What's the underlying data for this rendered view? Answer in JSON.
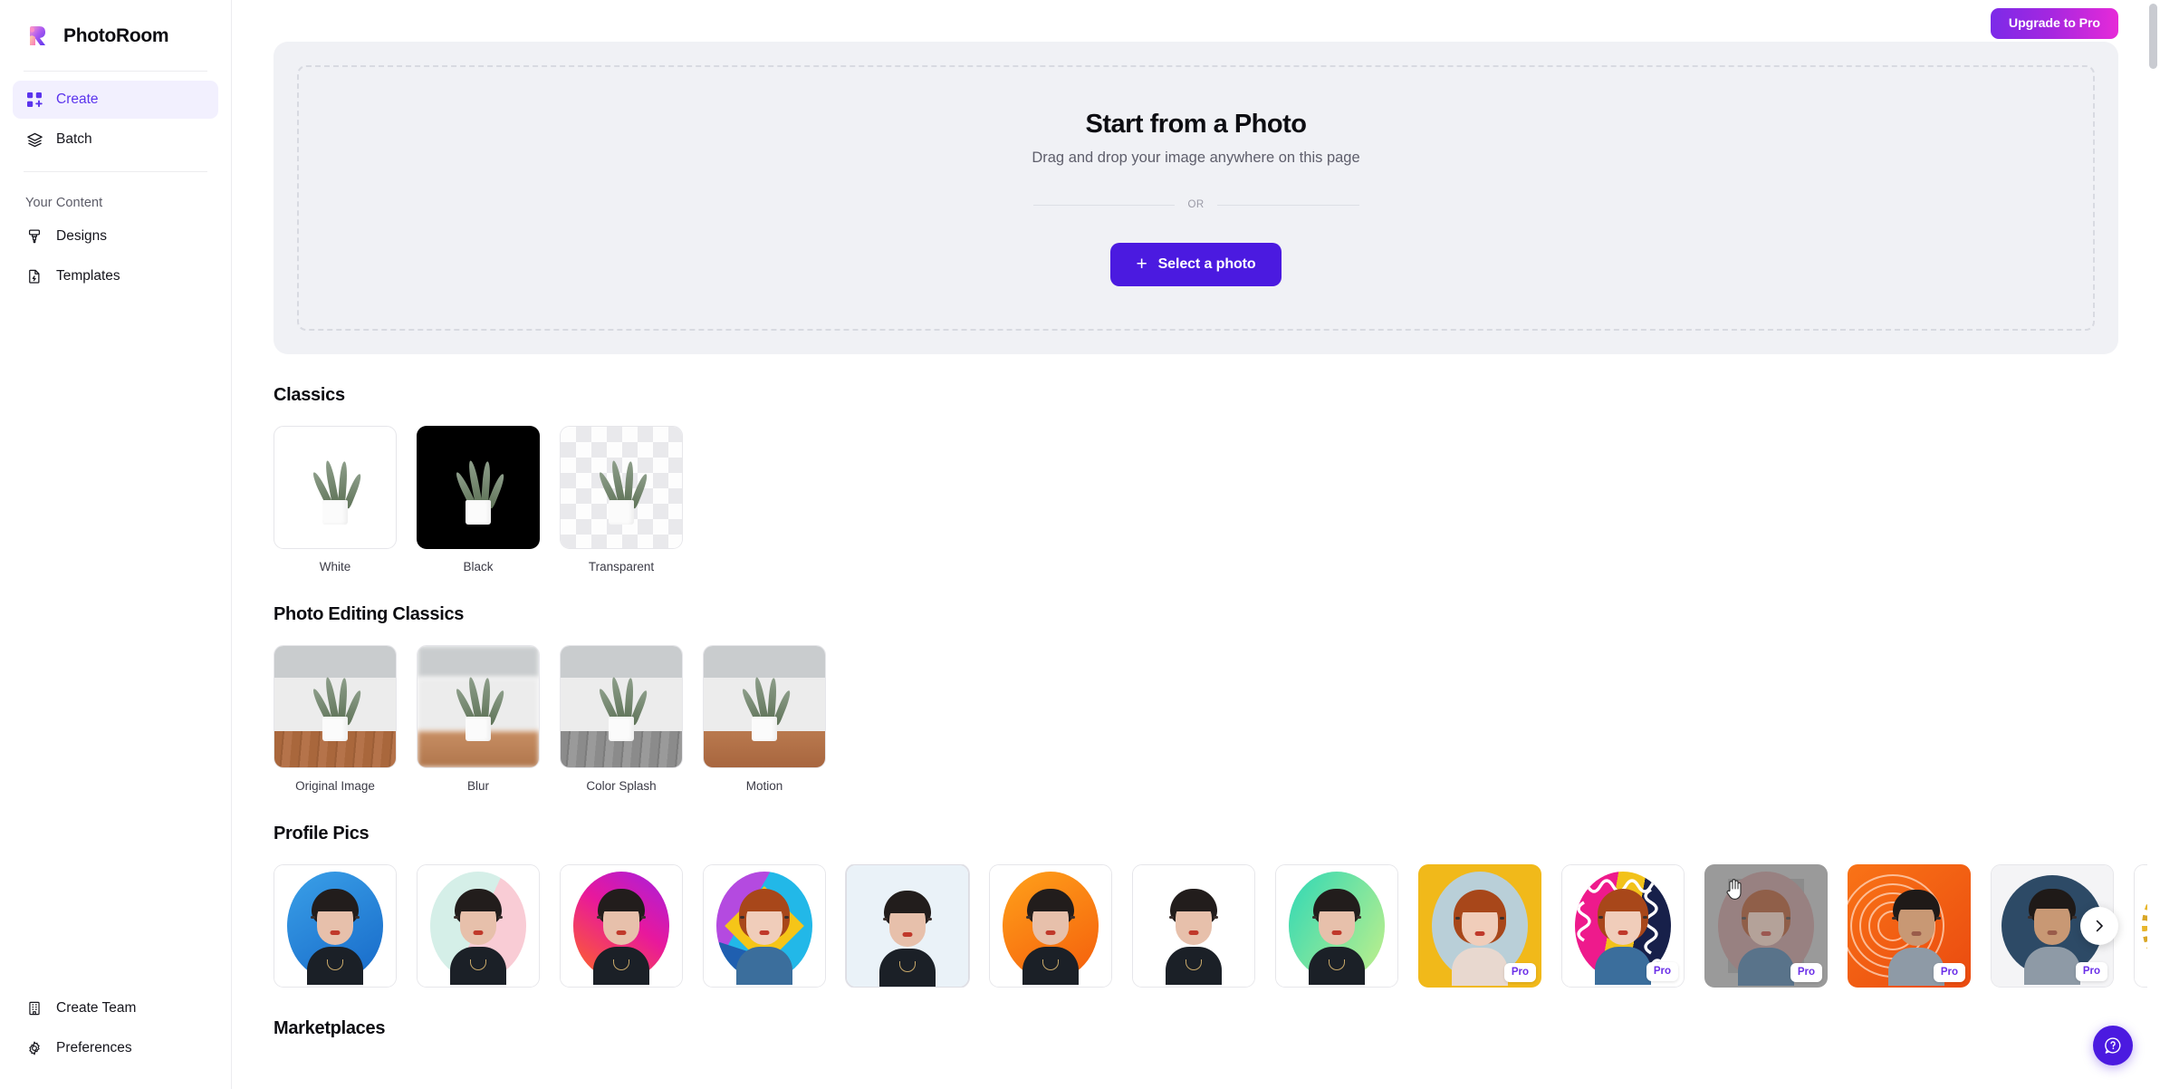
{
  "app": {
    "brand_name": "PhotoRoom",
    "logo_icon": "photoroom-logo-icon"
  },
  "sidebar": {
    "primary_items": [
      {
        "label": "Create",
        "icon": "grid-plus-icon",
        "active": true
      },
      {
        "label": "Batch",
        "icon": "layers-icon",
        "active": false
      }
    ],
    "section_label": "Your Content",
    "content_items": [
      {
        "label": "Designs",
        "icon": "paint-brush-icon"
      },
      {
        "label": "Templates",
        "icon": "template-file-icon"
      }
    ],
    "bottom_items": [
      {
        "label": "Create Team",
        "icon": "building-icon"
      },
      {
        "label": "Preferences",
        "icon": "gear-icon"
      }
    ]
  },
  "topbar": {
    "upgrade_label": "Upgrade to Pro"
  },
  "hero": {
    "title": "Start from a Photo",
    "subtitle": "Drag and drop your image anywhere on this page",
    "divider_label": "OR",
    "cta_label": "Select a photo",
    "cta_icon": "plus-icon"
  },
  "sections": [
    {
      "id": "classics",
      "title": "Classics",
      "items": [
        {
          "label": "White",
          "style": "white"
        },
        {
          "label": "Black",
          "style": "black"
        },
        {
          "label": "Transparent",
          "style": "transparent"
        }
      ]
    },
    {
      "id": "photo-editing-classics",
      "title": "Photo Editing Classics",
      "items": [
        {
          "label": "Original Image",
          "style": "original"
        },
        {
          "label": "Blur",
          "style": "blur"
        },
        {
          "label": "Color Splash",
          "style": "splash"
        },
        {
          "label": "Motion",
          "style": "motion"
        }
      ]
    },
    {
      "id": "profile-pics",
      "title": "Profile Pics",
      "items": [
        {
          "label": "",
          "pro": false,
          "bg": "blue-gradient",
          "subject": "woman-dark-hair"
        },
        {
          "label": "",
          "pro": false,
          "bg": "mint-pink-split",
          "subject": "woman-dark-hair"
        },
        {
          "label": "",
          "pro": false,
          "bg": "magenta-orange-gradient",
          "subject": "woman-dark-hair"
        },
        {
          "label": "",
          "pro": false,
          "bg": "yellow-diamond-cyan",
          "subject": "woman-red-hair"
        },
        {
          "label": "",
          "pro": false,
          "bg": "pale-blue-plain",
          "subject": "woman-dark-hair"
        },
        {
          "label": "",
          "pro": false,
          "bg": "orange-gradient",
          "subject": "woman-dark-hair"
        },
        {
          "label": "",
          "pro": false,
          "bg": "purple-magenta-gradient",
          "subject": "woman-dark-hair"
        },
        {
          "label": "",
          "pro": false,
          "bg": "teal-green-gradient",
          "subject": "woman-dark-hair"
        },
        {
          "label": "",
          "pro": true,
          "bg": "gold-solid",
          "subject": "woman-red-hair"
        },
        {
          "label": "",
          "pro": true,
          "bg": "pink-squiggle-navy",
          "subject": "woman-red-hair"
        },
        {
          "label": "",
          "pro": true,
          "bg": "grey-frame",
          "subject": "woman-red-hair",
          "hovered": true
        },
        {
          "label": "",
          "pro": true,
          "bg": "orange-rings",
          "subject": "man-dark-hair"
        },
        {
          "label": "",
          "pro": true,
          "bg": "navy-circle",
          "subject": "man-dark-hair"
        },
        {
          "label": "",
          "pro": false,
          "bg": "gold-sunburst",
          "subject": "woman-red-hair"
        }
      ],
      "pro_badge_label": "Pro",
      "next_icon": "chevron-right-icon"
    },
    {
      "id": "marketplaces",
      "title": "Marketplaces",
      "items": []
    }
  ],
  "help": {
    "icon": "question-chat-icon"
  },
  "colors": {
    "accent": "#4b1ae0",
    "accent_soft_bg": "#f2f0fe",
    "upgrade_gradient_start": "#7c2ae8",
    "upgrade_gradient_end": "#e62ad8",
    "hero_panel_bg": "#f0f1f5",
    "text_primary": "#0d0d12",
    "text_secondary": "#5e5e6b",
    "border": "#e6e6ea"
  }
}
